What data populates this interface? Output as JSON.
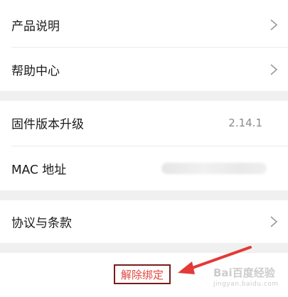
{
  "settings": {
    "product_manual": {
      "label": "产品说明"
    },
    "help_center": {
      "label": "帮助中心"
    },
    "firmware_upgrade": {
      "label": "固件版本升级",
      "value": "2.14.1"
    },
    "mac_address": {
      "label": "MAC 地址"
    },
    "terms": {
      "label": "协议与条款"
    }
  },
  "actions": {
    "unbind_label": "解除绑定"
  },
  "annotation": {
    "arrow_color": "#e23a36"
  },
  "watermark": {
    "text": "Bai百度经验",
    "sub": "jingyan.baidu.com"
  },
  "colors": {
    "background": "#f0f0f0",
    "card": "#ffffff",
    "unbind_text": "#e0483f",
    "highlight_border": "#7a1c1c"
  }
}
